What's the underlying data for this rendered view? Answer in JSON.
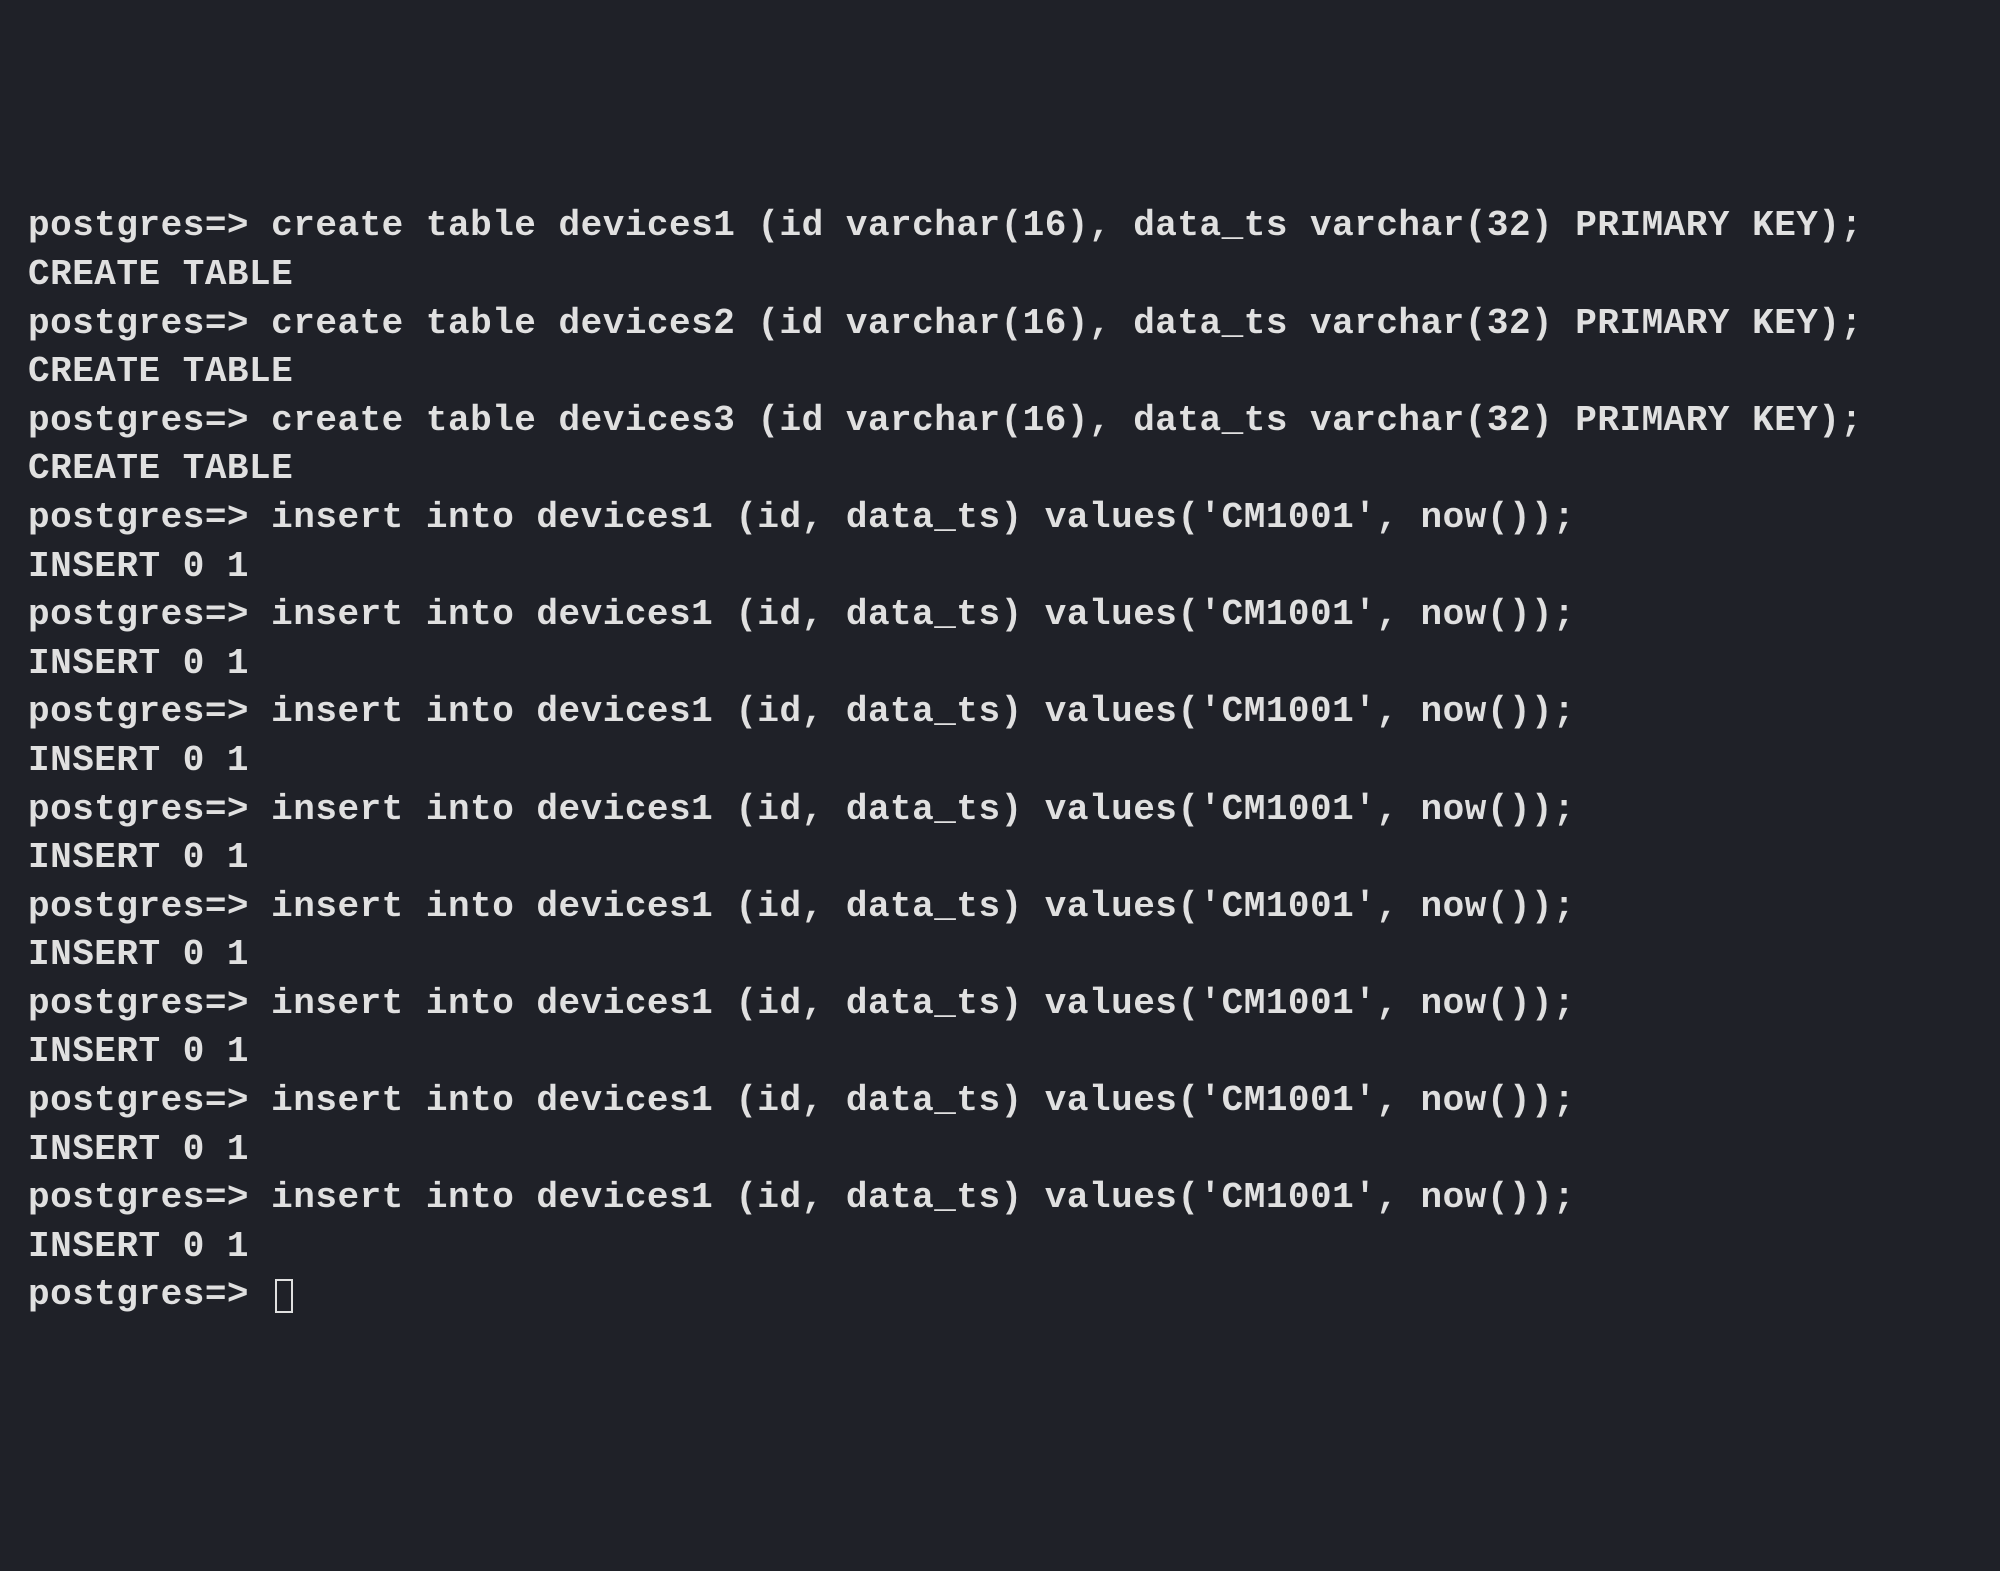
{
  "prompt": "postgres=>",
  "entries": [
    {
      "command": "create table devices1 (id varchar(16), data_ts varchar(32) PRIMARY KEY);",
      "response": "CREATE TABLE"
    },
    {
      "command": "create table devices2 (id varchar(16), data_ts varchar(32) PRIMARY KEY);",
      "response": "CREATE TABLE"
    },
    {
      "command": "create table devices3 (id varchar(16), data_ts varchar(32) PRIMARY KEY);",
      "response": "CREATE TABLE"
    },
    {
      "command": "insert into devices1 (id, data_ts) values('CM1001', now());",
      "response": "INSERT 0 1"
    },
    {
      "command": "insert into devices1 (id, data_ts) values('CM1001', now());",
      "response": "INSERT 0 1"
    },
    {
      "command": "insert into devices1 (id, data_ts) values('CM1001', now());",
      "response": "INSERT 0 1"
    },
    {
      "command": "insert into devices1 (id, data_ts) values('CM1001', now());",
      "response": "INSERT 0 1"
    },
    {
      "command": "insert into devices1 (id, data_ts) values('CM1001', now());",
      "response": "INSERT 0 1"
    },
    {
      "command": "insert into devices1 (id, data_ts) values('CM1001', now());",
      "response": "INSERT 0 1"
    },
    {
      "command": "insert into devices1 (id, data_ts) values('CM1001', now());",
      "response": "INSERT 0 1"
    },
    {
      "command": "insert into devices1 (id, data_ts) values('CM1001', now());",
      "response": "INSERT 0 1"
    }
  ],
  "final_prompt": "postgres=>"
}
